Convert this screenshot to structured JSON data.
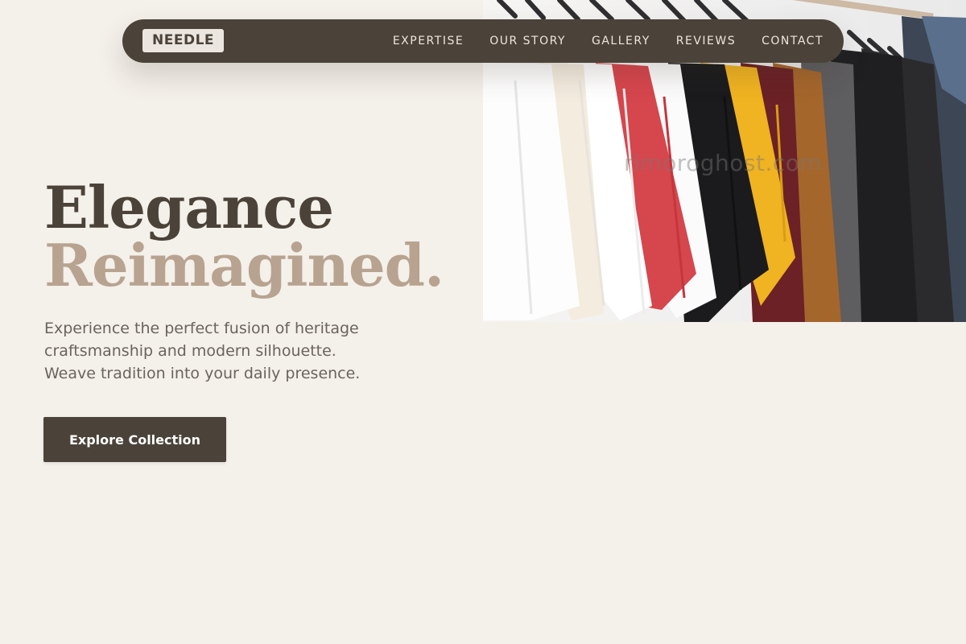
{
  "brand": {
    "logo_text": "NEEDLE"
  },
  "nav": {
    "links": [
      "EXPERTISE",
      "OUR STORY",
      "GALLERY",
      "REVIEWS",
      "CONTACT"
    ]
  },
  "hero": {
    "headline_line1": "Elegance",
    "headline_line2": "Reimagined.",
    "subtext_lines": [
      "Experience the perfect fusion of heritage",
      "craftsmanship and modern silhouette.",
      "Weave tradition into your daily presence."
    ],
    "cta_label": "Explore Collection",
    "image_watermark": "rimoroghost.com"
  },
  "colors": {
    "page_bg": "#f4f0ea",
    "nav_bg": "#4b4339",
    "primary_text": "#4b4339",
    "accent_text": "#b8a390",
    "body_text": "#6b645c",
    "button_bg": "#4b4339",
    "button_text": "#ffffff"
  }
}
